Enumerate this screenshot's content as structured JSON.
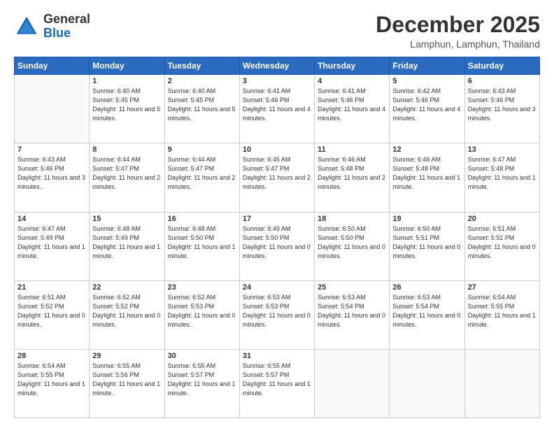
{
  "header": {
    "logo_general": "General",
    "logo_blue": "Blue",
    "month_title": "December 2025",
    "location": "Lamphun, Lamphun, Thailand"
  },
  "weekdays": [
    "Sunday",
    "Monday",
    "Tuesday",
    "Wednesday",
    "Thursday",
    "Friday",
    "Saturday"
  ],
  "weeks": [
    [
      {
        "num": "",
        "sunrise": "",
        "sunset": "",
        "daylight": ""
      },
      {
        "num": "1",
        "sunrise": "Sunrise: 6:40 AM",
        "sunset": "Sunset: 5:45 PM",
        "daylight": "Daylight: 11 hours and 5 minutes."
      },
      {
        "num": "2",
        "sunrise": "Sunrise: 6:40 AM",
        "sunset": "Sunset: 5:45 PM",
        "daylight": "Daylight: 11 hours and 5 minutes."
      },
      {
        "num": "3",
        "sunrise": "Sunrise: 6:41 AM",
        "sunset": "Sunset: 5:46 PM",
        "daylight": "Daylight: 11 hours and 4 minutes."
      },
      {
        "num": "4",
        "sunrise": "Sunrise: 6:41 AM",
        "sunset": "Sunset: 5:46 PM",
        "daylight": "Daylight: 11 hours and 4 minutes."
      },
      {
        "num": "5",
        "sunrise": "Sunrise: 6:42 AM",
        "sunset": "Sunset: 5:46 PM",
        "daylight": "Daylight: 11 hours and 4 minutes."
      },
      {
        "num": "6",
        "sunrise": "Sunrise: 6:43 AM",
        "sunset": "Sunset: 5:46 PM",
        "daylight": "Daylight: 11 hours and 3 minutes."
      }
    ],
    [
      {
        "num": "7",
        "sunrise": "Sunrise: 6:43 AM",
        "sunset": "Sunset: 5:46 PM",
        "daylight": "Daylight: 11 hours and 3 minutes."
      },
      {
        "num": "8",
        "sunrise": "Sunrise: 6:44 AM",
        "sunset": "Sunset: 5:47 PM",
        "daylight": "Daylight: 11 hours and 2 minutes."
      },
      {
        "num": "9",
        "sunrise": "Sunrise: 6:44 AM",
        "sunset": "Sunset: 5:47 PM",
        "daylight": "Daylight: 11 hours and 2 minutes."
      },
      {
        "num": "10",
        "sunrise": "Sunrise: 6:45 AM",
        "sunset": "Sunset: 5:47 PM",
        "daylight": "Daylight: 11 hours and 2 minutes."
      },
      {
        "num": "11",
        "sunrise": "Sunrise: 6:46 AM",
        "sunset": "Sunset: 5:48 PM",
        "daylight": "Daylight: 11 hours and 2 minutes."
      },
      {
        "num": "12",
        "sunrise": "Sunrise: 6:46 AM",
        "sunset": "Sunset: 5:48 PM",
        "daylight": "Daylight: 11 hours and 1 minute."
      },
      {
        "num": "13",
        "sunrise": "Sunrise: 6:47 AM",
        "sunset": "Sunset: 5:48 PM",
        "daylight": "Daylight: 11 hours and 1 minute."
      }
    ],
    [
      {
        "num": "14",
        "sunrise": "Sunrise: 6:47 AM",
        "sunset": "Sunset: 5:49 PM",
        "daylight": "Daylight: 11 hours and 1 minute."
      },
      {
        "num": "15",
        "sunrise": "Sunrise: 6:48 AM",
        "sunset": "Sunset: 5:49 PM",
        "daylight": "Daylight: 11 hours and 1 minute."
      },
      {
        "num": "16",
        "sunrise": "Sunrise: 6:48 AM",
        "sunset": "Sunset: 5:50 PM",
        "daylight": "Daylight: 11 hours and 1 minute."
      },
      {
        "num": "17",
        "sunrise": "Sunrise: 6:49 AM",
        "sunset": "Sunset: 5:50 PM",
        "daylight": "Daylight: 11 hours and 0 minutes."
      },
      {
        "num": "18",
        "sunrise": "Sunrise: 6:50 AM",
        "sunset": "Sunset: 5:50 PM",
        "daylight": "Daylight: 11 hours and 0 minutes."
      },
      {
        "num": "19",
        "sunrise": "Sunrise: 6:50 AM",
        "sunset": "Sunset: 5:51 PM",
        "daylight": "Daylight: 11 hours and 0 minutes."
      },
      {
        "num": "20",
        "sunrise": "Sunrise: 6:51 AM",
        "sunset": "Sunset: 5:51 PM",
        "daylight": "Daylight: 11 hours and 0 minutes."
      }
    ],
    [
      {
        "num": "21",
        "sunrise": "Sunrise: 6:51 AM",
        "sunset": "Sunset: 5:52 PM",
        "daylight": "Daylight: 11 hours and 0 minutes."
      },
      {
        "num": "22",
        "sunrise": "Sunrise: 6:52 AM",
        "sunset": "Sunset: 5:52 PM",
        "daylight": "Daylight: 11 hours and 0 minutes."
      },
      {
        "num": "23",
        "sunrise": "Sunrise: 6:52 AM",
        "sunset": "Sunset: 5:53 PM",
        "daylight": "Daylight: 11 hours and 0 minutes."
      },
      {
        "num": "24",
        "sunrise": "Sunrise: 6:53 AM",
        "sunset": "Sunset: 5:53 PM",
        "daylight": "Daylight: 11 hours and 0 minutes."
      },
      {
        "num": "25",
        "sunrise": "Sunrise: 6:53 AM",
        "sunset": "Sunset: 5:54 PM",
        "daylight": "Daylight: 11 hours and 0 minutes."
      },
      {
        "num": "26",
        "sunrise": "Sunrise: 6:53 AM",
        "sunset": "Sunset: 5:54 PM",
        "daylight": "Daylight: 11 hours and 0 minutes."
      },
      {
        "num": "27",
        "sunrise": "Sunrise: 6:54 AM",
        "sunset": "Sunset: 5:55 PM",
        "daylight": "Daylight: 11 hours and 1 minute."
      }
    ],
    [
      {
        "num": "28",
        "sunrise": "Sunrise: 6:54 AM",
        "sunset": "Sunset: 5:55 PM",
        "daylight": "Daylight: 11 hours and 1 minute."
      },
      {
        "num": "29",
        "sunrise": "Sunrise: 6:55 AM",
        "sunset": "Sunset: 5:56 PM",
        "daylight": "Daylight: 11 hours and 1 minute."
      },
      {
        "num": "30",
        "sunrise": "Sunrise: 6:55 AM",
        "sunset": "Sunset: 5:57 PM",
        "daylight": "Daylight: 11 hours and 1 minute."
      },
      {
        "num": "31",
        "sunrise": "Sunrise: 6:55 AM",
        "sunset": "Sunset: 5:57 PM",
        "daylight": "Daylight: 11 hours and 1 minute."
      },
      {
        "num": "",
        "sunrise": "",
        "sunset": "",
        "daylight": ""
      },
      {
        "num": "",
        "sunrise": "",
        "sunset": "",
        "daylight": ""
      },
      {
        "num": "",
        "sunrise": "",
        "sunset": "",
        "daylight": ""
      }
    ]
  ]
}
